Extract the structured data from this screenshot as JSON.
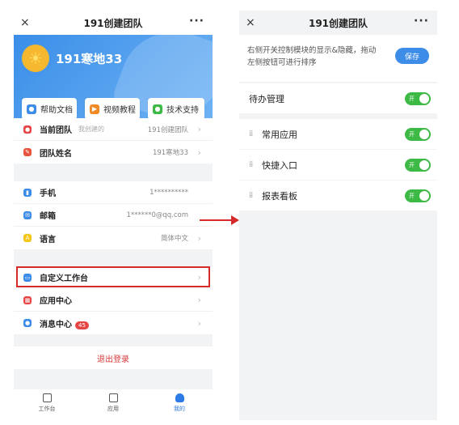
{
  "left": {
    "title": "191创建团队",
    "close": "×",
    "more": "···",
    "user_name": "191寒地33",
    "quick_links": [
      "帮助文档",
      "视频教程",
      "技术支持"
    ],
    "team_rows": [
      {
        "label": "当前团队",
        "hint": "我创建的",
        "value": "191创建团队"
      },
      {
        "label": "团队姓名",
        "value": "191寒地33"
      }
    ],
    "info_rows": [
      {
        "label": "手机",
        "value": "1**********"
      },
      {
        "label": "邮箱",
        "value": "1******0@qq.com"
      },
      {
        "label": "语言",
        "value": "简体中文"
      }
    ],
    "menu_rows": [
      {
        "label": "自定义工作台"
      },
      {
        "label": "应用中心"
      },
      {
        "label": "消息中心",
        "badge": "45"
      }
    ],
    "logout": "退出登录",
    "tabs": [
      "工作台",
      "应用",
      "我的"
    ]
  },
  "right": {
    "title": "191创建团队",
    "close": "×",
    "more": "···",
    "tip": "右侧开关控制模块的显示&隐藏，拖动左侧按钮可进行排序",
    "save": "保存",
    "toggle_text": "开",
    "modules": [
      {
        "label": "待办管理"
      },
      {
        "label": "常用应用"
      },
      {
        "label": "快捷入口"
      },
      {
        "label": "报表看板"
      }
    ]
  },
  "colors": {
    "accent": "#3c8ce8",
    "toggle": "#3db945",
    "highlight": "#d72b2b",
    "logout": "#d93a3a"
  }
}
